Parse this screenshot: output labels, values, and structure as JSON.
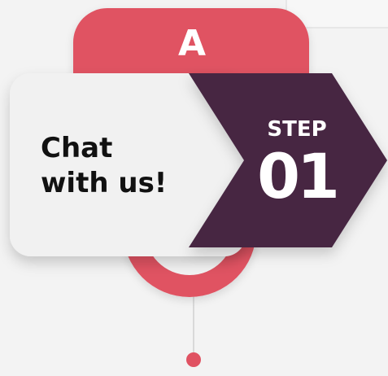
{
  "diagram": {
    "letter": "A",
    "title_line1": "Chat",
    "title_line2": "with us!",
    "step_word": "STEP",
    "step_number": "01"
  },
  "colors": {
    "background": "#f3f3f3",
    "accent_red": "#e05262",
    "dark_purple": "#472743",
    "card": "#f1f1f1",
    "text": "#111111"
  }
}
